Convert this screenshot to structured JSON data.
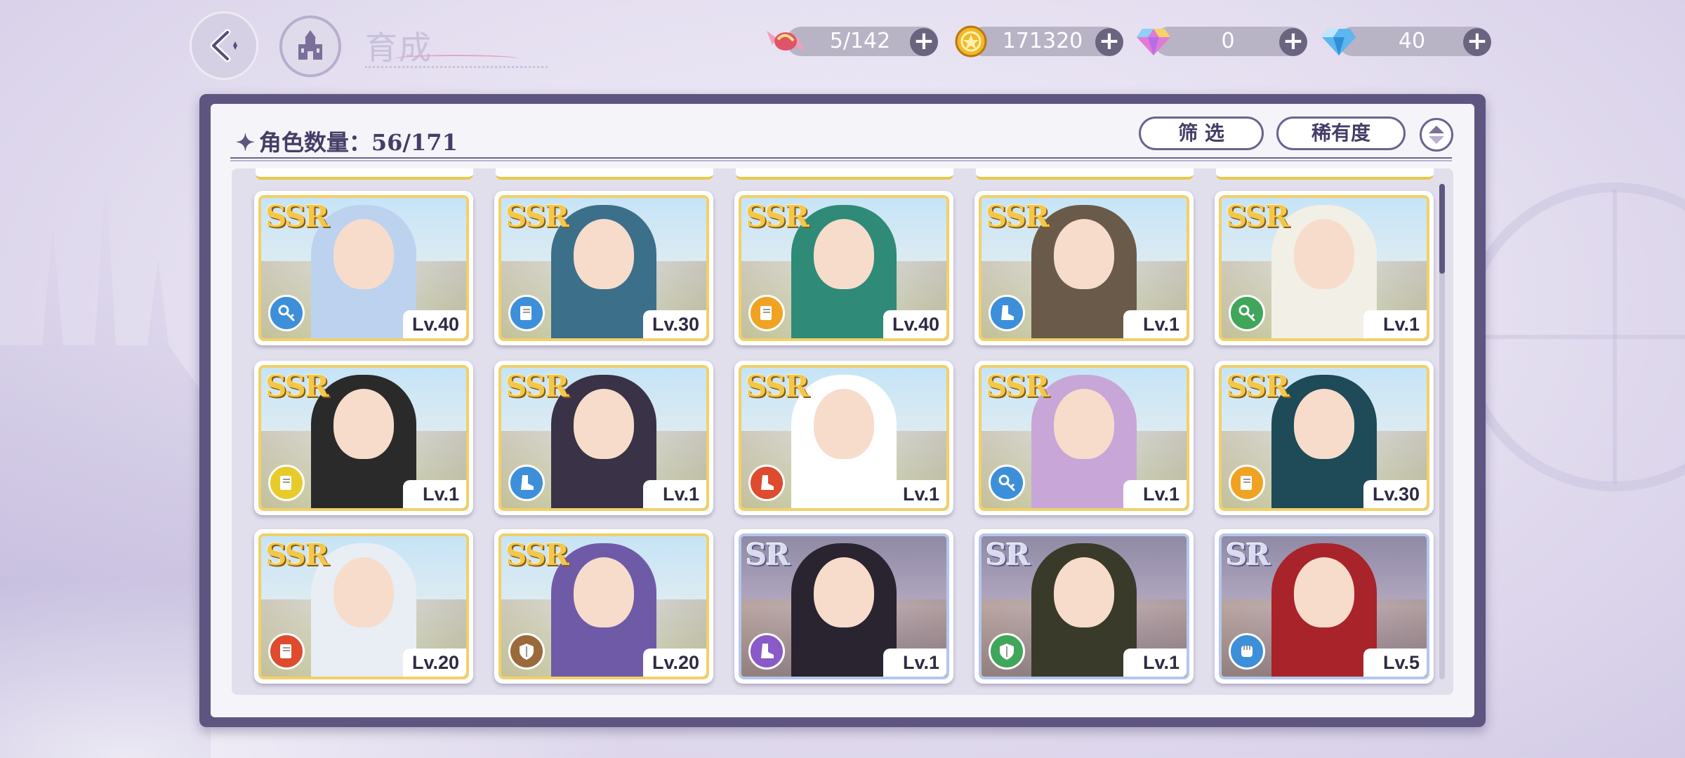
{
  "header": {
    "title": "育成",
    "resources": [
      {
        "name": "candy",
        "value": "5/142",
        "icon": "candy-icon",
        "color": "#e0546a"
      },
      {
        "name": "gold",
        "value": "171320",
        "icon": "gold-coin-icon",
        "color": "#f3b72a"
      },
      {
        "name": "gem-pink",
        "value": "0",
        "icon": "rainbow-gem-icon",
        "color": "#d76bd8"
      },
      {
        "name": "gem-blue",
        "value": "40",
        "icon": "blue-diamond-icon",
        "color": "#5db6ef"
      }
    ]
  },
  "panel": {
    "count_label": "角色数量：56/171",
    "filter_label": "筛 选",
    "sort_label": "稀有度"
  },
  "class_colors": {
    "blue": "#3d8fd9",
    "orange": "#f0a322",
    "green": "#3fa65a",
    "yellow": "#e8cb2a",
    "red": "#de4b2e",
    "brown": "#9a6a3a",
    "purple": "#8a5ac8"
  },
  "cards": [
    {
      "rarity": "SSR",
      "level": "Lv.40",
      "class_color": "blue",
      "class_icon": "key-icon",
      "hair": "#e7b98a",
      "outfit": "#bcd2ef"
    },
    {
      "rarity": "SSR",
      "level": "Lv.30",
      "class_color": "blue",
      "class_icon": "book-icon",
      "hair": "#f0d98f",
      "outfit": "#3c6f8a"
    },
    {
      "rarity": "SSR",
      "level": "Lv.40",
      "class_color": "orange",
      "class_icon": "book-icon",
      "hair": "#a0613a",
      "outfit": "#2f8a78"
    },
    {
      "rarity": "SSR",
      "level": "Lv.1",
      "class_color": "blue",
      "class_icon": "boot-icon",
      "hair": "#a8e4d4",
      "outfit": "#6a5a4a"
    },
    {
      "rarity": "SSR",
      "level": "Lv.1",
      "class_color": "green",
      "class_icon": "key-icon",
      "hair": "#d6d2c6",
      "outfit": "#f2efe6"
    },
    {
      "rarity": "SSR",
      "level": "Lv.1",
      "class_color": "yellow",
      "class_icon": "book-icon",
      "hair": "#c9b690",
      "outfit": "#2a2a2a"
    },
    {
      "rarity": "SSR",
      "level": "Lv.1",
      "class_color": "blue",
      "class_icon": "boot-icon",
      "hair": "#e6e6ea",
      "outfit": "#3a3246"
    },
    {
      "rarity": "SSR",
      "level": "Lv.1",
      "class_color": "red",
      "class_icon": "boot-icon",
      "hair": "#e296b4",
      "outfit": "#ffffff"
    },
    {
      "rarity": "SSR",
      "level": "Lv.1",
      "class_color": "blue",
      "class_icon": "key-icon",
      "hair": "#f4bccd",
      "outfit": "#c9a6d8"
    },
    {
      "rarity": "SSR",
      "level": "Lv.30",
      "class_color": "orange",
      "class_icon": "book-icon",
      "hair": "#2a3452",
      "outfit": "#1f4a58"
    },
    {
      "rarity": "SSR",
      "level": "Lv.20",
      "class_color": "red",
      "class_icon": "book-icon",
      "hair": "#b8323c",
      "outfit": "#e9eef5"
    },
    {
      "rarity": "SSR",
      "level": "Lv.20",
      "class_color": "brown",
      "class_icon": "shield-icon",
      "hair": "#c2c2c2",
      "outfit": "#6f5aa8"
    },
    {
      "rarity": "SR",
      "level": "Lv.1",
      "class_color": "purple",
      "class_icon": "boot-icon",
      "hair": "#d8a6b0",
      "outfit": "#2a2430"
    },
    {
      "rarity": "SR",
      "level": "Lv.1",
      "class_color": "green",
      "class_icon": "shield-icon",
      "hair": "#a7d64a",
      "outfit": "#3a3a2a"
    },
    {
      "rarity": "SR",
      "level": "Lv.5",
      "class_color": "blue",
      "class_icon": "fist-icon",
      "hair": "#e0552a",
      "outfit": "#a8232a"
    }
  ]
}
